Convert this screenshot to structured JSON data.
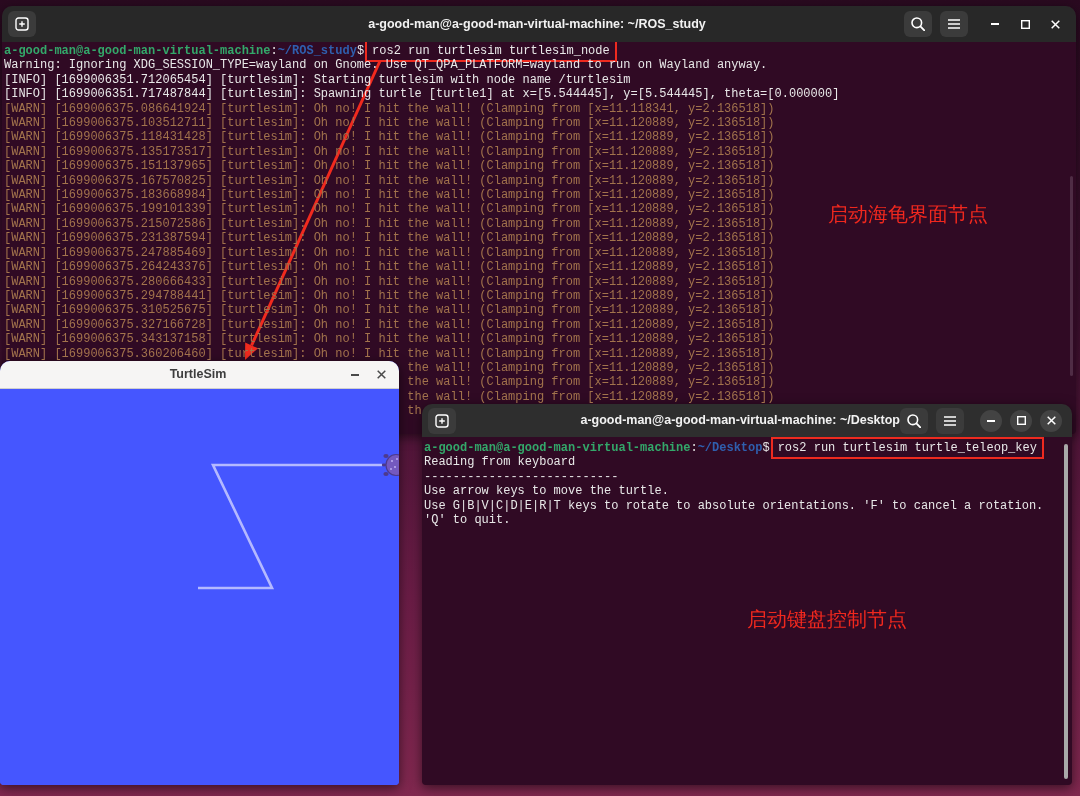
{
  "terminal_main": {
    "title": "a-good-man@a-good-man-virtual-machine: ~/ROS_study",
    "focused": false,
    "lines": [
      {
        "kind": "prompt",
        "user_host": "a-good-man@a-good-man-virtual-machine",
        "separator": ":",
        "path": "~/ROS_study",
        "symbol": "$",
        "command": "ros2 run turtlesim turtlesim_node",
        "highlighted": true
      },
      {
        "kind": "plain",
        "text": "Warning: Ignoring XDG_SESSION_TYPE=wayland on Gnome. Use QT_QPA_PLATFORM=wayland to run on Wayland anyway."
      },
      {
        "kind": "plain",
        "text": "[INFO] [1699006351.712065454] [turtlesim]: Starting turtlesim with node name /turtlesim"
      },
      {
        "kind": "plain",
        "text": "[INFO] [1699006351.717487844] [turtlesim]: Spawning turtle [turtle1] at x=[5.544445], y=[5.544445], theta=[0.000000]"
      },
      {
        "kind": "warn",
        "text": "[WARN] [1699006375.086641924] [turtlesim]: Oh no! I hit the wall! (Clamping from [x=11.118341, y=2.136518])"
      },
      {
        "kind": "warn",
        "text": "[WARN] [1699006375.103512711] [turtlesim]: Oh no! I hit the wall! (Clamping from [x=11.120889, y=2.136518])"
      },
      {
        "kind": "warn",
        "text": "[WARN] [1699006375.118431428] [turtlesim]: Oh no! I hit the wall! (Clamping from [x=11.120889, y=2.136518])"
      },
      {
        "kind": "warn",
        "text": "[WARN] [1699006375.135173517] [turtlesim]: Oh no! I hit the wall! (Clamping from [x=11.120889, y=2.136518])"
      },
      {
        "kind": "warn",
        "text": "[WARN] [1699006375.151137965] [turtlesim]: Oh no! I hit the wall! (Clamping from [x=11.120889, y=2.136518])"
      },
      {
        "kind": "warn",
        "text": "[WARN] [1699006375.167570825] [turtlesim]: Oh no! I hit the wall! (Clamping from [x=11.120889, y=2.136518])"
      },
      {
        "kind": "warn",
        "text": "[WARN] [1699006375.183668984] [turtlesim]: Oh no! I hit the wall! (Clamping from [x=11.120889, y=2.136518])"
      },
      {
        "kind": "warn",
        "text": "[WARN] [1699006375.199101339] [turtlesim]: Oh no! I hit the wall! (Clamping from [x=11.120889, y=2.136518])"
      },
      {
        "kind": "warn",
        "text": "[WARN] [1699006375.215072586] [turtlesim]: Oh no! I hit the wall! (Clamping from [x=11.120889, y=2.136518])"
      },
      {
        "kind": "warn",
        "text": "[WARN] [1699006375.231387594] [turtlesim]: Oh no! I hit the wall! (Clamping from [x=11.120889, y=2.136518])"
      },
      {
        "kind": "warn",
        "text": "[WARN] [1699006375.247885469] [turtlesim]: Oh no! I hit the wall! (Clamping from [x=11.120889, y=2.136518])"
      },
      {
        "kind": "warn",
        "text": "[WARN] [1699006375.264243376] [turtlesim]: Oh no! I hit the wall! (Clamping from [x=11.120889, y=2.136518])"
      },
      {
        "kind": "warn",
        "text": "[WARN] [1699006375.280666433] [turtlesim]: Oh no! I hit the wall! (Clamping from [x=11.120889, y=2.136518])"
      },
      {
        "kind": "warn",
        "text": "[WARN] [1699006375.294788441] [turtlesim]: Oh no! I hit the wall! (Clamping from [x=11.120889, y=2.136518])"
      },
      {
        "kind": "warn",
        "text": "[WARN] [1699006375.310525675] [turtlesim]: Oh no! I hit the wall! (Clamping from [x=11.120889, y=2.136518])"
      },
      {
        "kind": "warn",
        "text": "[WARN] [1699006375.327166728] [turtlesim]: Oh no! I hit the wall! (Clamping from [x=11.120889, y=2.136518])"
      },
      {
        "kind": "warn",
        "text": "[WARN] [1699006375.343137158] [turtlesim]: Oh no! I hit the wall! (Clamping from [x=11.120889, y=2.136518])"
      },
      {
        "kind": "warn",
        "text": "[WARN] [1699006375.360206460] [turtlesim]: Oh no! I hit the wall! (Clamping from [x=11.120889, y=2.136518])"
      },
      {
        "kind": "warn_tail",
        "text": "the wall! (Clamping from [x=11.120889, y=2.136518])"
      },
      {
        "kind": "warn_tail",
        "text": "the wall! (Clamping from [x=11.120889, y=2.136518])"
      },
      {
        "kind": "warn_tail",
        "text": "the wall! (Clamping from [x=11.120889, y=2.136518])"
      },
      {
        "kind": "warn_tail",
        "text": "th"
      }
    ],
    "annotation": "启动海龟界面节点"
  },
  "turtlesim": {
    "title": "TurtleSim"
  },
  "terminal_desktop": {
    "title": "a-good-man@a-good-man-virtual-machine: ~/Desktop",
    "focused": true,
    "lines": [
      {
        "kind": "prompt",
        "user_host": "a-good-man@a-good-man-virtual-machine",
        "separator": ":",
        "path": "~/Desktop",
        "symbol": "$",
        "command": "ros2 run turtlesim turtle_teleop_key",
        "highlighted": true
      },
      {
        "kind": "plain",
        "text": "Reading from keyboard"
      },
      {
        "kind": "plain",
        "text": "---------------------------"
      },
      {
        "kind": "plain",
        "text": "Use arrow keys to move the turtle."
      },
      {
        "kind": "plain",
        "text": "Use G|B|V|C|D|E|R|T keys to rotate to absolute orientations. 'F' to cancel a rotation."
      },
      {
        "kind": "plain",
        "text": "'Q' to quit."
      }
    ],
    "annotation": "启动键盘控制节点"
  }
}
